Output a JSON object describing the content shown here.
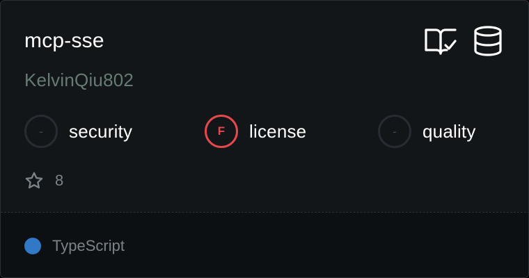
{
  "card": {
    "title": "mcp-sse",
    "author": "KelvinQiu802",
    "header_icons": [
      "book-check-icon",
      "database-icon"
    ],
    "metrics": [
      {
        "badge": "-",
        "label": "security",
        "status": "none"
      },
      {
        "badge": "F",
        "label": "license",
        "status": "fail",
        "color": "#e5484d"
      },
      {
        "badge": "-",
        "label": "quality",
        "status": "none"
      }
    ],
    "stars": {
      "icon": "star-icon",
      "count": "8"
    },
    "language": {
      "name": "TypeScript",
      "color": "#3178c6"
    }
  }
}
